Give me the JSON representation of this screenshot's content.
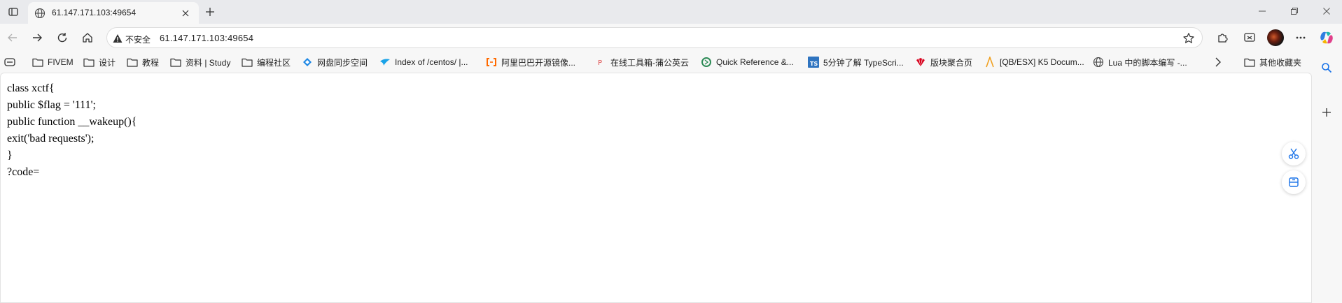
{
  "browser": {
    "tab": {
      "title": "61.147.171.103:49654"
    },
    "omnibox": {
      "security_label": "不安全",
      "url": "61.147.171.103:49654"
    }
  },
  "bookmarks": [
    {
      "label": "FIVEM",
      "icon": "folder-icon"
    },
    {
      "label": "设计",
      "icon": "folder-icon"
    },
    {
      "label": "教程",
      "icon": "folder-icon"
    },
    {
      "label": "资料 | Study",
      "icon": "folder-icon"
    },
    {
      "label": "编程社区",
      "icon": "folder-icon"
    },
    {
      "label": "网盘同步空间",
      "icon": "site-icon"
    },
    {
      "label": "Index of /centos/ |...",
      "icon": "site-icon"
    },
    {
      "label": "阿里巴巴开源镜像...",
      "icon": "site-icon"
    },
    {
      "label": "在线工具箱-蒲公英云",
      "icon": "site-icon"
    },
    {
      "label": "Quick Reference &...",
      "icon": "site-icon"
    },
    {
      "label": "5分钟了解 TypeScri...",
      "icon": "site-icon"
    },
    {
      "label": "版块聚合页",
      "icon": "site-icon"
    },
    {
      "label": "[QB/ESX] K5 Docum...",
      "icon": "site-icon"
    },
    {
      "label": "Lua 中的脚本编写 -...",
      "icon": "globe-icon"
    }
  ],
  "other_bookmarks": {
    "label": "其他收藏夹"
  },
  "page": {
    "lines": [
      "class xctf{",
      "public $flag = '111';",
      "public function __wakeup(){",
      "exit('bad requests');",
      "}",
      "?code="
    ]
  },
  "colors": {
    "accent": "#1a73e8",
    "tab_active": "#f7f7f7",
    "tabstrip": "#e9eaed",
    "page_bg": "#ffffff"
  }
}
